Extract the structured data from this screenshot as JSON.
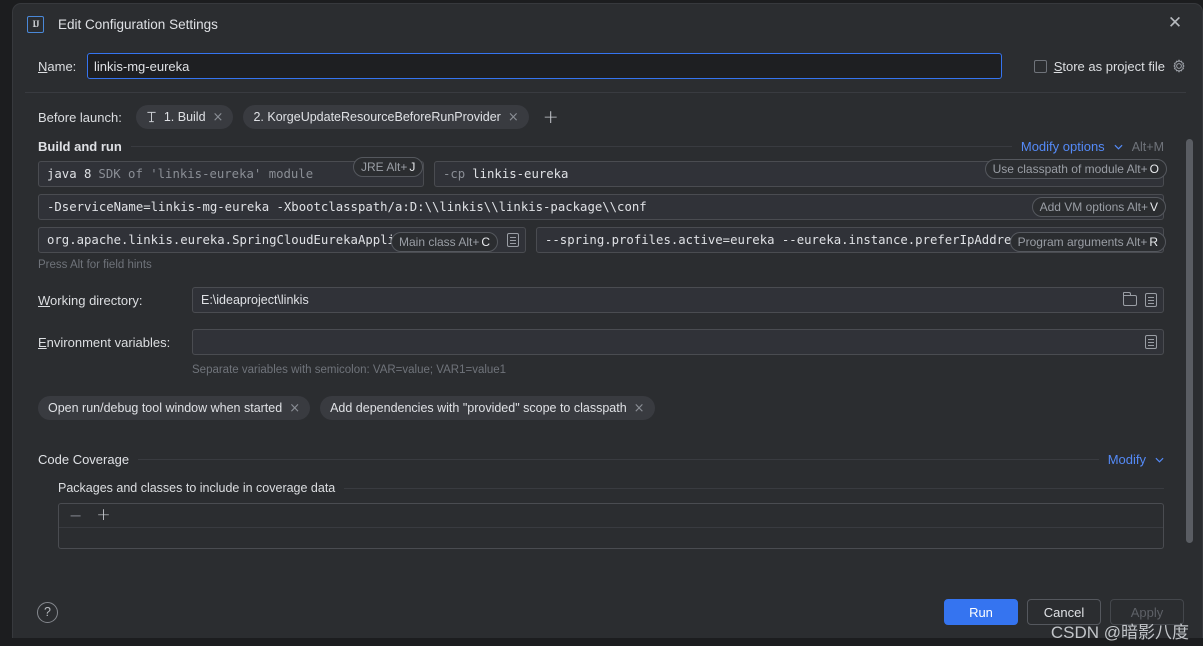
{
  "window": {
    "title": "Edit Configuration Settings",
    "logo_icon": "intellij-idea-logo",
    "close_icon": "close-icon"
  },
  "name_row": {
    "label": "Name:",
    "label_mnemonic": "N",
    "value": "linkis-mg-eureka",
    "store_as_project_file": "Store as project file",
    "store_mnemonic": "S",
    "gear_icon": "gear-icon"
  },
  "before_launch": {
    "label": "Before launch:",
    "tasks": [
      {
        "label": "1. Build",
        "icon": "build-hammer-icon",
        "close": "×"
      },
      {
        "label": "2. KorgeUpdateResourceBeforeRunProvider",
        "icon": "",
        "close": "×"
      }
    ],
    "add_label": "+"
  },
  "build_and_run": {
    "title": "Build and run",
    "modify_options_link": "Modify options",
    "modify_options_shortcut": "Alt+M",
    "jre_tip": "JRE Alt+",
    "jre_tip_key": "J",
    "classpath_tip": "Use classpath of module Alt+",
    "classpath_tip_key": "O",
    "vm_tip": "Add VM options Alt+",
    "vm_tip_key": "V",
    "mainclass_tip": "Main class Alt+",
    "mainclass_tip_key": "C",
    "progargs_tip": "Program arguments Alt+",
    "progargs_tip_key": "R",
    "jre_value": "java 8",
    "jre_hint": "SDK of 'linkis-eureka' module",
    "classpath_prefix": "-cp",
    "classpath_value": "linkis-eureka",
    "vm_options": "-DserviceName=linkis-mg-eureka -Xbootclasspath/a:D:\\\\linkis\\\\linkis-package\\\\conf",
    "main_class": "org.apache.linkis.eureka.SpringCloudEurekaApplication",
    "program_arguments": "--spring.profiles.active=eureka --eureka.instance.preferIpAddress=true",
    "field_hint": "Press Alt for field hints",
    "caret_icon": "chevron-down-icon",
    "doc_icon": "insert-macro-icon",
    "expand_icon": "expand-editor-icon"
  },
  "working_directory": {
    "label": "Working directory:",
    "mnemonic": "W",
    "value": "E:\\ideaproject\\linkis",
    "folder_icon": "folder-icon",
    "macro_icon": "insert-macro-icon"
  },
  "environment_variables": {
    "label": "Environment variables:",
    "mnemonic": "E",
    "value": "",
    "hint": "Separate variables with semicolon: VAR=value; VAR1=value1",
    "macro_icon": "insert-macro-icon"
  },
  "option_chips": [
    {
      "label": "Open run/debug tool window when started",
      "close": "×"
    },
    {
      "label": "Add dependencies with \"provided\" scope to classpath",
      "close": "×"
    }
  ],
  "code_coverage": {
    "title": "Code Coverage",
    "modify_link": "Modify",
    "subtitle": "Packages and classes to include in coverage data",
    "remove_icon": "minus-icon",
    "add_icon": "plus-icon"
  },
  "footer": {
    "help_icon": "help-icon",
    "help_label": "?",
    "run_label": "Run",
    "cancel_label": "Cancel",
    "apply_label": "Apply"
  },
  "watermark": {
    "text": "CSDN @暗影八度"
  },
  "colors": {
    "accent_blue": "#3574f0",
    "link_blue": "#548af7",
    "dialog_bg": "#2b2d30",
    "field_bg": "#303238",
    "text": "#dfe1e5",
    "muted": "#6f737a"
  }
}
